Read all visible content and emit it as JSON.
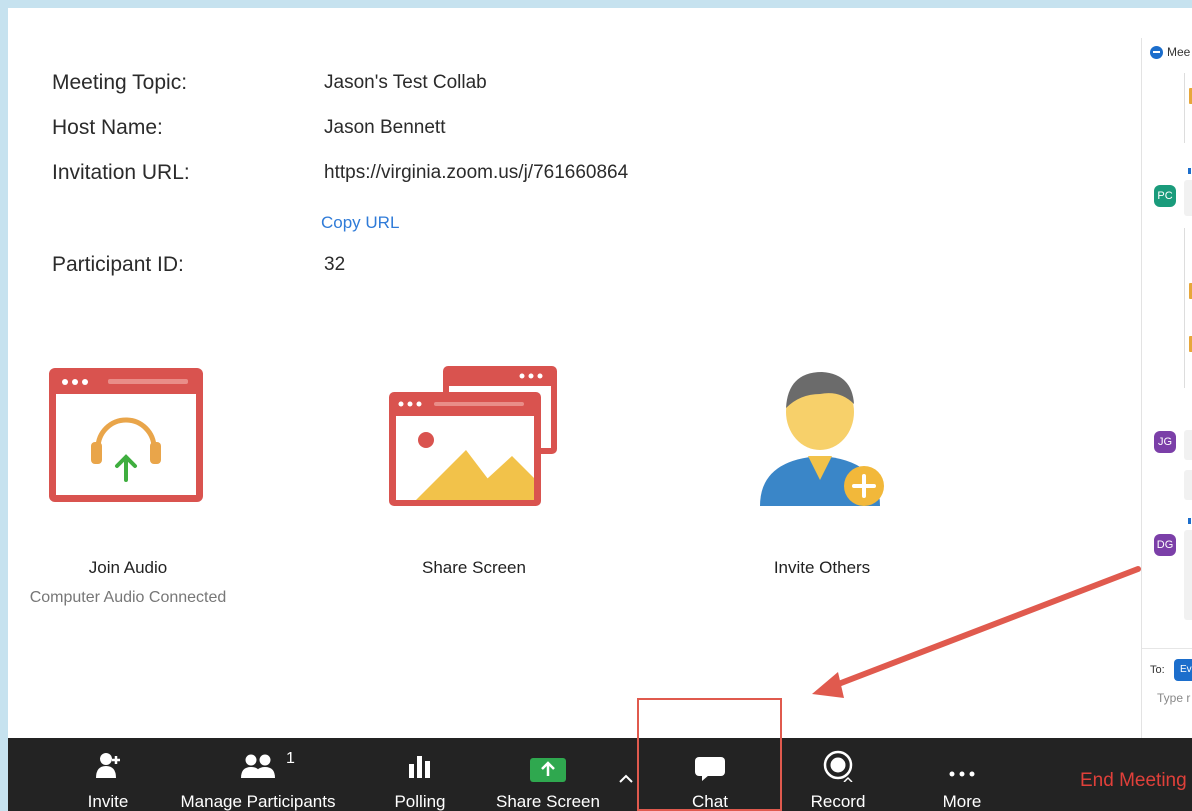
{
  "meeting_info": {
    "topic_label": "Meeting Topic:",
    "topic_value": "Jason's Test Collab",
    "host_label": "Host Name:",
    "host_value": "Jason Bennett",
    "url_label": "Invitation URL:",
    "url_value": "https://virginia.zoom.us/j/761660864",
    "copy_url": "Copy URL",
    "participant_label": "Participant ID:",
    "participant_value": "32"
  },
  "tiles": {
    "join_audio": "Join Audio",
    "join_audio_status": "Computer Audio Connected",
    "share_screen": "Share Screen",
    "invite_others": "Invite Others"
  },
  "chat_panel": {
    "title_fragment": "Mee",
    "to_label": "To:",
    "recipient_fragment": "Ev",
    "input_fragment": "Type r",
    "avatars": [
      "PC",
      "JG",
      "DG"
    ],
    "avatar_colors": [
      "#1a9b7b",
      "#7b3fa8",
      "#7b3fa8"
    ]
  },
  "toolbar": {
    "invite": "Invite",
    "manage_participants": "Manage Participants",
    "participant_count": "1",
    "polling": "Polling",
    "share_screen": "Share Screen",
    "chat": "Chat",
    "record": "Record",
    "more": "More",
    "end_meeting": "End Meeting"
  },
  "colors": {
    "toolbar_bg": "#232323",
    "share_green": "#2fa84f",
    "end_red": "#e0403a",
    "link_blue": "#2f7bd8",
    "annotation_red": "#e05a4e"
  },
  "icons": [
    "headphones-icon",
    "share-screen-icon",
    "invite-person-icon",
    "invite-icon",
    "participants-icon",
    "polling-icon",
    "share-arrow-icon",
    "caret-up-icon",
    "chat-bubble-icon",
    "record-icon",
    "more-dots-icon"
  ]
}
